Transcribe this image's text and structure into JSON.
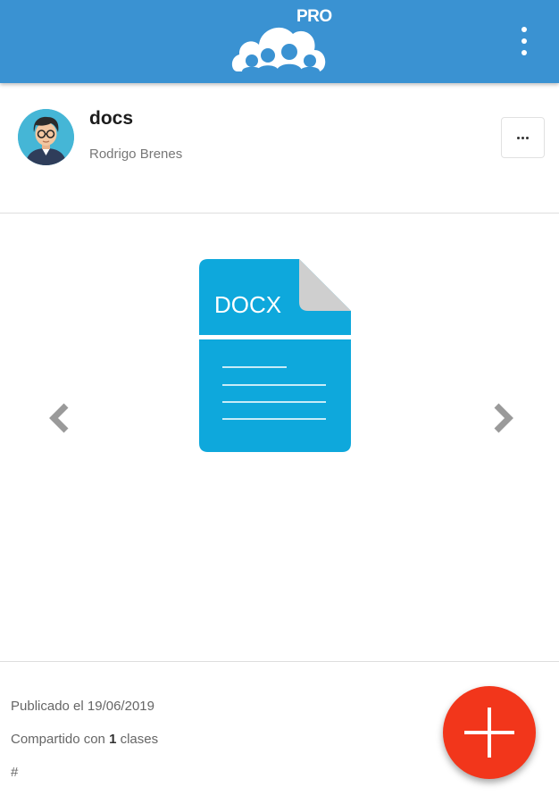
{
  "app": {
    "logo_badge": "PRO",
    "brand_color": "#3a92d2",
    "icons": {
      "logo": "cloud-group-icon",
      "overflow": "more-vert-icon"
    }
  },
  "post": {
    "title": "docs",
    "author": "Rodrigo Brenes",
    "more_icon": "more-horiz-icon"
  },
  "attachment": {
    "type_label": "DOCX",
    "icon_color": "#0ea8dc",
    "prev_icon": "chevron-left-icon",
    "next_icon": "chevron-right-icon"
  },
  "meta": {
    "published": "Publicado el 19/06/2019",
    "shared_prefix": "Compartido con ",
    "shared_count": "1",
    "shared_suffix": " clases",
    "tags": "#"
  },
  "fab": {
    "icon": "plus-icon",
    "color": "#f2361b"
  }
}
